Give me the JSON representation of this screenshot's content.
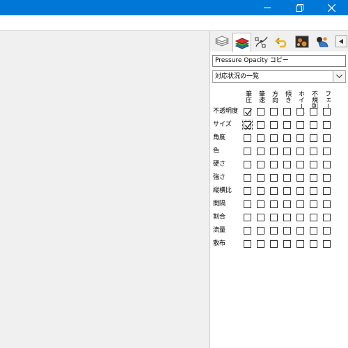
{
  "window": {
    "controls": [
      {
        "name": "minimize-icon"
      },
      {
        "name": "restore-icon"
      },
      {
        "name": "close-icon"
      }
    ]
  },
  "panel": {
    "tabs": [
      {
        "icon": "layers-icon",
        "active": false
      },
      {
        "icon": "color-stack-icon",
        "active": true
      },
      {
        "icon": "curve-nodes-icon",
        "active": false
      },
      {
        "icon": "undo-history-icon",
        "active": false
      },
      {
        "icon": "brush-preset-icon",
        "active": false
      },
      {
        "icon": "brush-settings-icon",
        "active": false
      }
    ],
    "scroll_icon": "arrow-left-icon",
    "preset_name": "Pressure Opacity コピー",
    "view_select": {
      "value": "対応状況の一覧"
    },
    "columns": [
      "筆圧",
      "筆速",
      "方向",
      "傾き",
      "ホイール",
      "不規則",
      "フェード"
    ],
    "rows": [
      {
        "label": "不透明度",
        "checks": [
          true,
          false,
          false,
          false,
          false,
          false,
          false
        ]
      },
      {
        "label": "サイズ",
        "checks": [
          true,
          false,
          false,
          false,
          false,
          false,
          false
        ]
      },
      {
        "label": "角度",
        "checks": [
          false,
          false,
          false,
          false,
          false,
          false,
          false
        ]
      },
      {
        "label": "色",
        "checks": [
          false,
          false,
          false,
          false,
          false,
          false,
          false
        ]
      },
      {
        "label": "硬さ",
        "checks": [
          false,
          false,
          false,
          false,
          false,
          false,
          false
        ]
      },
      {
        "label": "強さ",
        "checks": [
          false,
          false,
          false,
          false,
          false,
          false,
          false
        ]
      },
      {
        "label": "縦横比",
        "checks": [
          false,
          false,
          false,
          false,
          false,
          false,
          false
        ]
      },
      {
        "label": "間隔",
        "checks": [
          false,
          false,
          false,
          false,
          false,
          false,
          false
        ]
      },
      {
        "label": "割合",
        "checks": [
          false,
          false,
          false,
          false,
          false,
          false,
          false
        ]
      },
      {
        "label": "流量",
        "checks": [
          false,
          false,
          false,
          false,
          false,
          false,
          false
        ]
      },
      {
        "label": "散布",
        "checks": [
          false,
          false,
          false,
          false,
          false,
          false,
          false
        ]
      }
    ],
    "focused_cell": {
      "row": 1,
      "col": 0
    }
  },
  "colors": {
    "titlebar": "#0078d7"
  }
}
